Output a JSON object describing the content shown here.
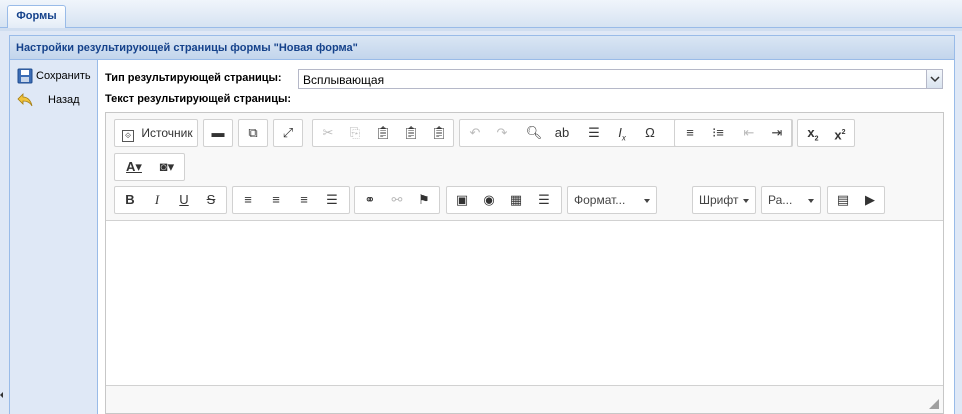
{
  "tabs": [
    {
      "label": "Формы"
    }
  ],
  "panel": {
    "title": "Настройки результирующей страницы формы \"Новая форма\""
  },
  "sidebar": {
    "save_label": "Сохранить",
    "back_label": "Назад"
  },
  "form": {
    "type_label": "Тип результирующей страницы:",
    "type_value": "Всплывающая",
    "text_label": "Текст результирующей страницы:"
  },
  "editor": {
    "source_label": "Источник",
    "format_label": "Формат...",
    "font_label": "Шрифт",
    "size_label": "Ра..."
  }
}
